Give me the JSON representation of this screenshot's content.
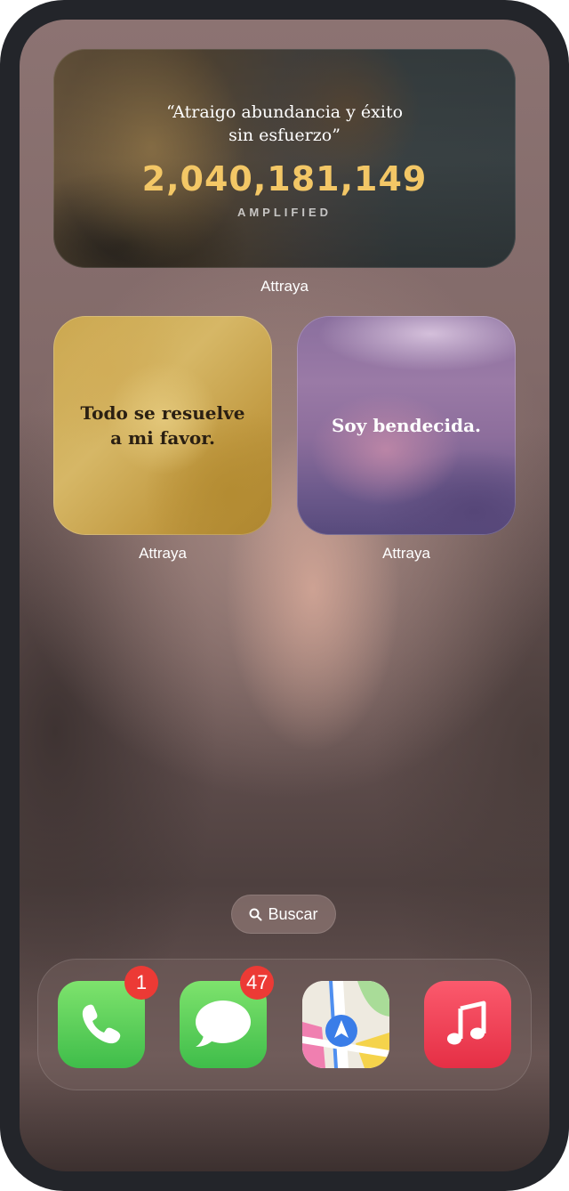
{
  "widgets": {
    "top": {
      "quote": "“Atraigo abundancia y éxito sin esfuerzo”",
      "counter": "2,040,181,149",
      "caption": "AMPLIFIED",
      "app_label": "Attraya"
    },
    "left": {
      "text_line1": "Todo se resuelve",
      "text_line2": "a mi favor.",
      "app_label": "Attraya"
    },
    "right": {
      "text": "Soy bendecida.",
      "app_label": "Attraya"
    }
  },
  "search": {
    "label": "Buscar",
    "icon": "magnifying-glass"
  },
  "dock": {
    "apps": [
      {
        "name": "Phone",
        "icon": "phone-handset",
        "badge": "1"
      },
      {
        "name": "Messages",
        "icon": "speech-bubble",
        "badge": "47"
      },
      {
        "name": "Maps",
        "icon": "map-navigation-arrow",
        "badge": ""
      },
      {
        "name": "Music",
        "icon": "music-note",
        "badge": ""
      }
    ]
  },
  "colors": {
    "counter": "#f3c766",
    "badge": "#ec3a35",
    "phone_green": "#3fbd4a",
    "music_red": "#e52f45"
  }
}
